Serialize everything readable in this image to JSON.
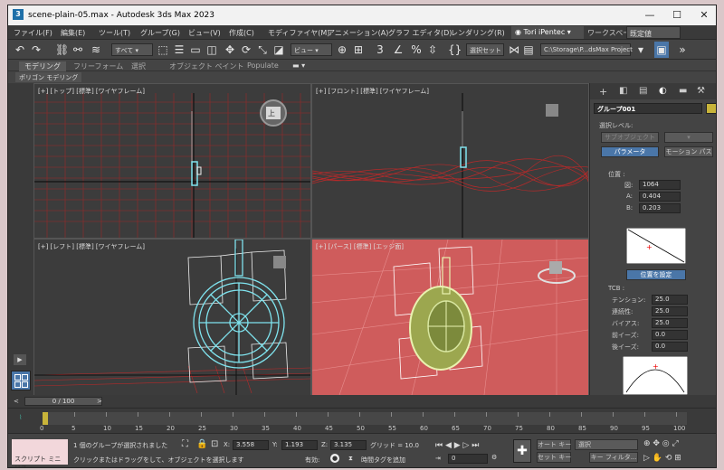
{
  "window": {
    "title": "scene-plain-05.max - Autodesk 3ds Max 2023",
    "minimize": "—",
    "maximize": "☐",
    "close": "✕"
  },
  "menu": [
    "ファイル(F)",
    "編集(E)",
    "ツール(T)",
    "グループ(G)",
    "ビュー(V)",
    "作成(C)",
    "モディファイヤ(M)",
    "アニメーション(A)",
    "グラフ エディタ(D)",
    "レンダリング(R)"
  ],
  "user": "Tori iPentec",
  "workspace": {
    "label": "ワークスペース:",
    "value": "既定値"
  },
  "toolbar": {
    "selection_filter": "すべて",
    "view_ref": "ビュー",
    "selset": "選択セット",
    "path": "C:\\Storage\\P...dsMax Project"
  },
  "ribbon": {
    "tabs": [
      "モデリング",
      "フリーフォーム",
      "選択",
      "オブジェクト ペイント",
      "Populate"
    ],
    "active": 0,
    "sub": "ポリゴン モデリング"
  },
  "viewports": [
    {
      "label": "[+] [トップ] [標準] [ワイヤフレーム]",
      "bg": "#3d3d3d"
    },
    {
      "label": "[+] [フロント] [標準] [ワイヤフレーム]",
      "bg": "#3d3d3d"
    },
    {
      "label": "[+] [レフト] [標準] [ワイヤフレーム]",
      "bg": "#3d3d3d"
    },
    {
      "label": "[+] [パース] [標準] [エッジ面]",
      "bg": "#cf5c5c"
    }
  ],
  "viewcube": {
    "top": "上"
  },
  "cmd": {
    "object_name": "グループ001",
    "sel_level_label": "選択レベル:",
    "sub_object": "サブオブジェクト",
    "params": "パラメータ",
    "motion_path": "モーション パス",
    "position": "位置 :",
    "fields": [
      {
        "label": "図:",
        "value": "1064"
      },
      {
        "label": "A:",
        "value": "0.404"
      },
      {
        "label": "B:",
        "value": "0.203"
      }
    ],
    "set_pos": "位置を設定",
    "tcb": "TCB :",
    "tcb_fields": [
      {
        "label": "テンション:",
        "value": "25.0"
      },
      {
        "label": "連続性:",
        "value": "25.0"
      },
      {
        "label": "バイアス:",
        "value": "25.0"
      },
      {
        "label": "前イーズ:",
        "value": "0.0"
      },
      {
        "label": "後イーズ:",
        "value": "0.0"
      }
    ]
  },
  "time": {
    "slider": "0 / 100",
    "ticks": [
      "0",
      "5",
      "10",
      "15",
      "20",
      "25",
      "30",
      "35",
      "40",
      "45",
      "50",
      "55",
      "60",
      "65",
      "70",
      "75",
      "80",
      "85",
      "90",
      "95",
      "100"
    ]
  },
  "status": {
    "script": "スクリプト ミニ リス",
    "msg1": "1 個のグループが選択されました",
    "msg2": "クリックまたはドラッグをして、オブジェクトを選択します",
    "x_label": "X:",
    "x": "3.558",
    "y_label": "Y:",
    "y": "1.193",
    "z_label": "Z:",
    "z": "3.135",
    "grid": "グリッド = 10.0",
    "enable": "有効:",
    "add_tag": "時間タグを追加",
    "frame": "0",
    "autokey": "オート キー",
    "setkey": "セット キー",
    "sel_mode": "選択",
    "key_filter": "キー フィルタ..."
  },
  "colors": {
    "wire_red": "#b52a2a",
    "wire_cyan": "#7fe3ee",
    "accent_blue": "#4a76a8",
    "swatch": "#c8b43a",
    "persp_bg": "#cf5c5c"
  }
}
